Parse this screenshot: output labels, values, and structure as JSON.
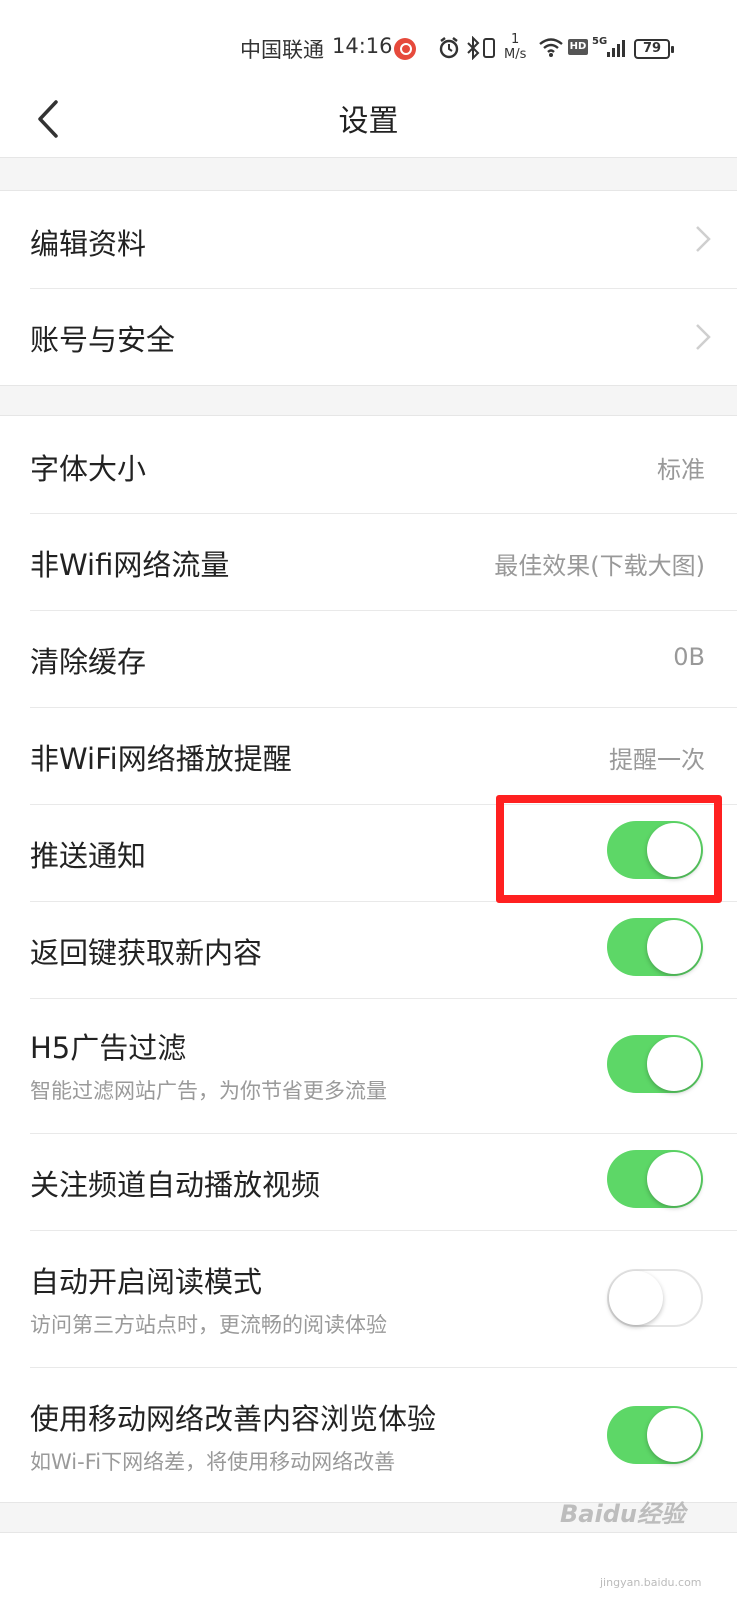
{
  "status_bar": {
    "carrier": "中国联通",
    "time": "14:16",
    "net_speed_top": "1",
    "net_speed_unit": "M/s",
    "hd_badge": "HD",
    "network": "5G",
    "battery": "79"
  },
  "header": {
    "title": "设置"
  },
  "group1": [
    {
      "title": "编辑资料"
    },
    {
      "title": "账号与安全"
    }
  ],
  "group2": [
    {
      "title": "字体大小",
      "value": "标准"
    },
    {
      "title": "非Wifi网络流量",
      "value": "最佳效果(下载大图)"
    },
    {
      "title": "清除缓存",
      "value": "0B"
    },
    {
      "title": "非WiFi网络播放提醒",
      "value": "提醒一次"
    },
    {
      "title": "推送通知",
      "toggle": true
    },
    {
      "title": "返回键获取新内容",
      "toggle": true
    },
    {
      "title": "H5广告过滤",
      "subtitle": "智能过滤网站广告，为你节省更多流量",
      "toggle": true
    },
    {
      "title": "关注频道自动播放视频",
      "toggle": true
    },
    {
      "title": "自动开启阅读模式",
      "subtitle": "访问第三方站点时，更流畅的阅读体验",
      "toggle": false
    },
    {
      "title": "使用移动网络改善内容浏览体验",
      "subtitle": "如Wi-Fi下网络差，将使用移动网络改善",
      "toggle": true
    }
  ],
  "colors": {
    "toggle_on": "#5dd767",
    "highlight": "#ff2020"
  },
  "watermark": {
    "text": "Baidu经验",
    "sub": "jingyan.baidu.com"
  }
}
